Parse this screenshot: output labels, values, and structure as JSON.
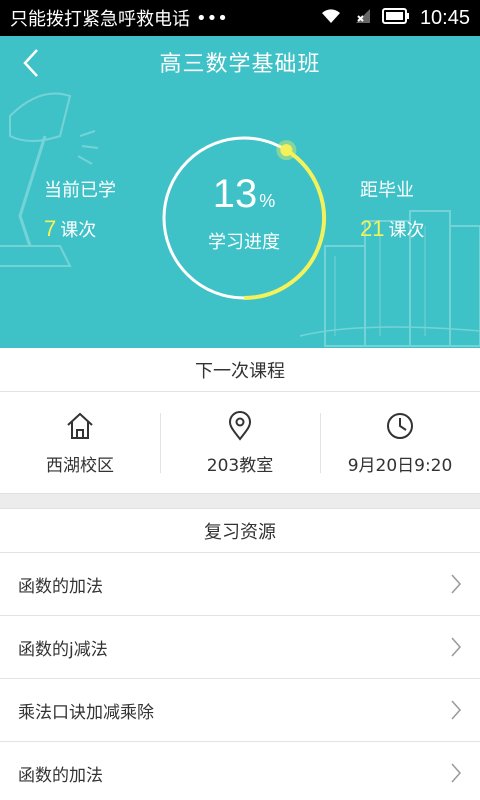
{
  "status_bar": {
    "notification_text": "只能拨打紧急呼救电话",
    "dots": "•••",
    "time": "10:45"
  },
  "header": {
    "title": "高三数学基础班"
  },
  "progress": {
    "percent_text": "13",
    "percent_unit": "%",
    "percent_value": 0.13,
    "label": "学习进度",
    "learned_title": "当前已学",
    "learned_count": "7",
    "learned_unit": "课次",
    "remaining_title": "距毕业",
    "remaining_count": "21",
    "remaining_unit": "课次"
  },
  "next_class": {
    "title": "下一次课程",
    "campus": "西湖校区",
    "room": "203教室",
    "time": "9月20日9:20"
  },
  "review": {
    "title": "复习资源",
    "items": [
      {
        "label": "函数的加法"
      },
      {
        "label": "函数的j减法"
      },
      {
        "label": "乘法口诀加减乘除"
      },
      {
        "label": "函数的加法"
      }
    ]
  },
  "colors": {
    "accent": "#3ec2c7",
    "highlight": "#f4f25a"
  }
}
